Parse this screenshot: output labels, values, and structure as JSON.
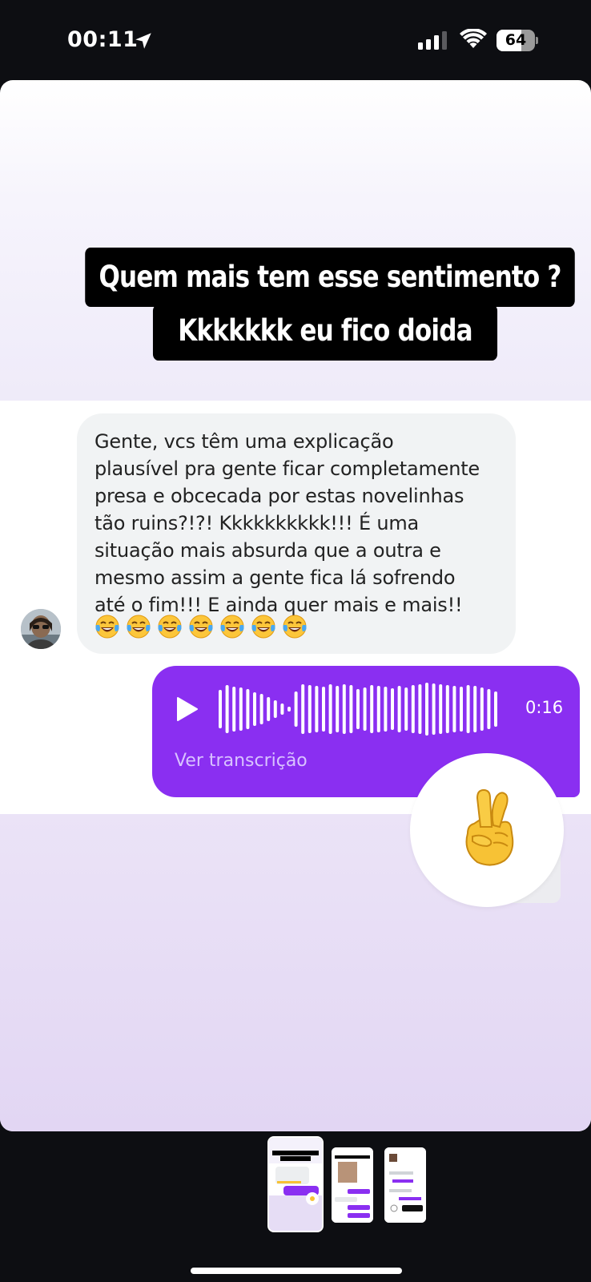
{
  "status_bar": {
    "time": "00:11",
    "battery_level": "64",
    "battery_fraction": 0.64,
    "icons": [
      "location-arrow-icon",
      "cellular-signal-icon",
      "wifi-icon",
      "battery-icon"
    ]
  },
  "story": {
    "caption_line_1": "Quem mais tem esse sentimento ?",
    "caption_line_2": "Kkkkkkk eu fico doida",
    "incoming_message": {
      "text": "Gente, vcs têm uma explicação\nplausível pra gente ficar completamente\npresa e obcecada por estas novelinhas\ntão ruins?!?! Kkkkkkkkkk!!! É uma\nsituação mais absurda que a outra e\nmesmo assim a gente fica lá sofrendo\naté o fim!!!  E ainda quer mais e mais!!",
      "emoji": "face-with-tears-of-joy",
      "emoji_count": 7
    },
    "voice_message": {
      "duration": "0:16",
      "transcript_label": "Ver transcrição",
      "bubble_color": "#8a2ff1"
    },
    "reaction": {
      "emoji": "crossed-fingers"
    }
  },
  "story_tray": {
    "thumbnail_count": 3,
    "selected_index": 0
  }
}
